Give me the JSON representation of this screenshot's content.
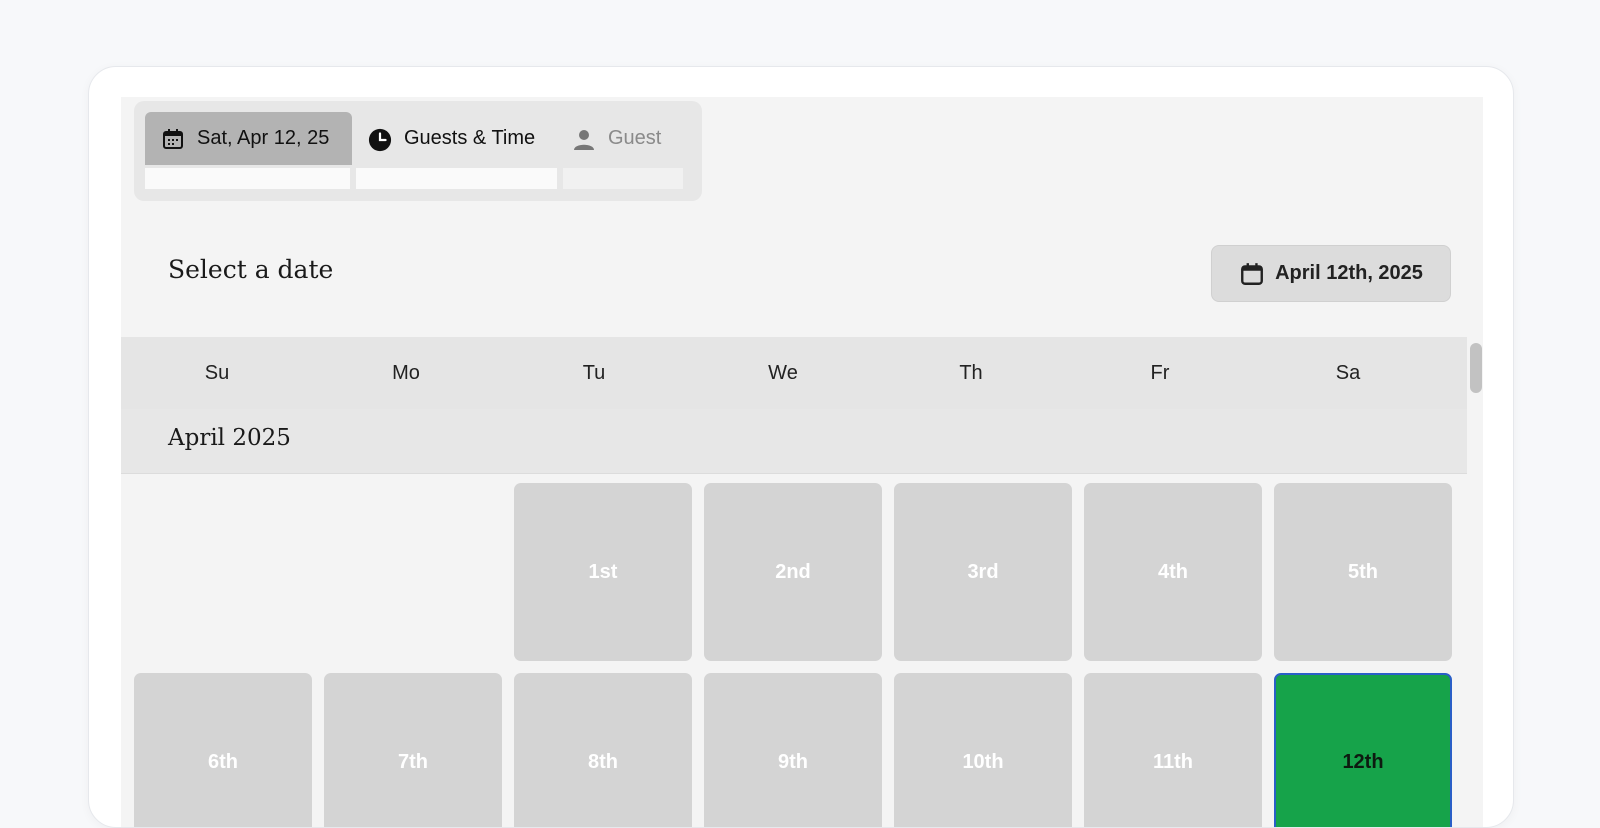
{
  "tabs": {
    "date": {
      "label": "Sat, Apr 12, 25",
      "icon": "calendar-icon"
    },
    "guests_time": {
      "label": "Guests & Time",
      "icon": "clock-icon"
    },
    "guest": {
      "label": "Guest",
      "icon": "person-icon"
    }
  },
  "header": {
    "title": "Select a date",
    "date_button": {
      "label": "April 12th, 2025",
      "icon": "calendar-icon"
    }
  },
  "weekdays": [
    "Su",
    "Mo",
    "Tu",
    "We",
    "Th",
    "Fr",
    "Sa"
  ],
  "month": {
    "label": "April 2025"
  },
  "days": [
    {
      "label": "1st",
      "selected": false
    },
    {
      "label": "2nd",
      "selected": false
    },
    {
      "label": "3rd",
      "selected": false
    },
    {
      "label": "4th",
      "selected": false
    },
    {
      "label": "5th",
      "selected": false
    },
    {
      "label": "6th",
      "selected": false
    },
    {
      "label": "7th",
      "selected": false
    },
    {
      "label": "8th",
      "selected": false
    },
    {
      "label": "9th",
      "selected": false
    },
    {
      "label": "10th",
      "selected": false
    },
    {
      "label": "11th",
      "selected": false
    },
    {
      "label": "12th",
      "selected": true
    }
  ],
  "colors": {
    "selected_day": "#16a34a",
    "selected_border": "#2a5fc7",
    "day_tile": "#d4d4d4"
  }
}
